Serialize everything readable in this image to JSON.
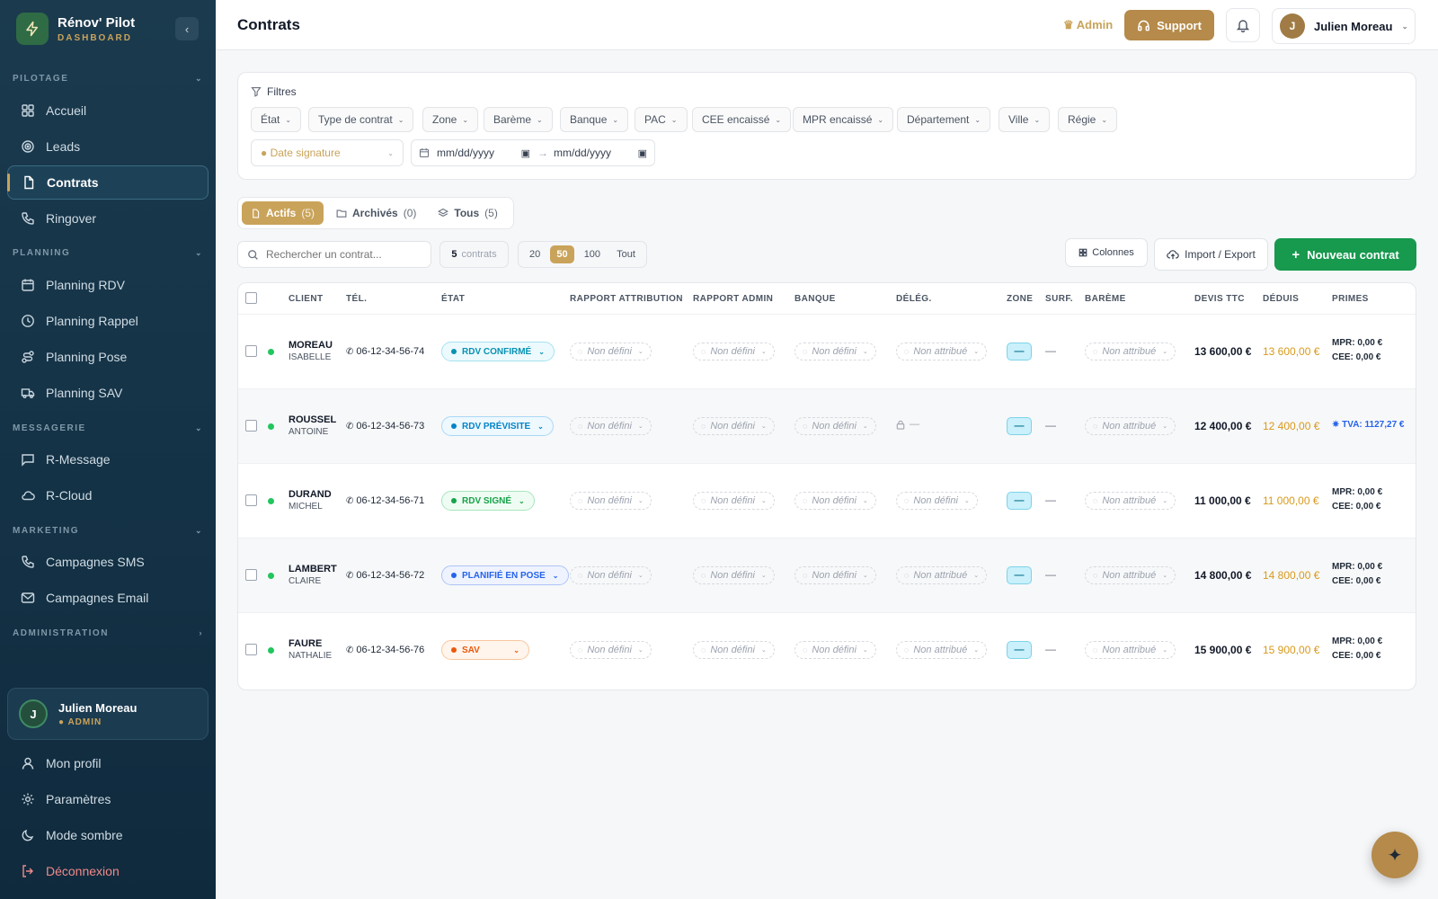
{
  "brand": {
    "name": "Rénov' Pilot",
    "sub": "DASHBOARD"
  },
  "sidebar": {
    "sections": [
      {
        "label": "PILOTAGE"
      },
      {
        "label": "PLANNING"
      },
      {
        "label": "MESSAGERIE"
      },
      {
        "label": "MARKETING"
      },
      {
        "label": "ADMINISTRATION"
      }
    ],
    "items": [
      {
        "label": "Accueil",
        "icon": "grid-icon"
      },
      {
        "label": "Leads",
        "icon": "target-icon"
      },
      {
        "label": "Contrats",
        "icon": "document-icon",
        "active": true
      },
      {
        "label": "Ringover",
        "icon": "phone-icon"
      },
      {
        "label": "Planning RDV",
        "icon": "calendar-icon"
      },
      {
        "label": "Planning Rappel",
        "icon": "clock-icon"
      },
      {
        "label": "Planning Pose",
        "icon": "route-icon"
      },
      {
        "label": "Planning SAV",
        "icon": "truck-icon"
      },
      {
        "label": "R-Message",
        "icon": "message-icon"
      },
      {
        "label": "R-Cloud",
        "icon": "cloud-icon"
      },
      {
        "label": "Campagnes SMS",
        "icon": "phone-icon"
      },
      {
        "label": "Campagnes Email",
        "icon": "mail-icon"
      }
    ],
    "user": {
      "name": "Julien Moreau",
      "initial": "J",
      "role": "ADMIN"
    },
    "bottom": [
      {
        "label": "Mon profil",
        "icon": "user-icon"
      },
      {
        "label": "Paramètres",
        "icon": "gear-icon"
      },
      {
        "label": "Mode sombre",
        "icon": "moon-icon"
      },
      {
        "label": "Déconnexion",
        "icon": "logout-icon"
      }
    ]
  },
  "header": {
    "title": "Contrats",
    "admin_label": "Admin",
    "support_label": "Support",
    "user_name": "Julien Moreau",
    "user_initial": "J"
  },
  "filters": {
    "title": "Filtres",
    "chips": [
      "État",
      "Type de contrat",
      "Zone",
      "Barème",
      "Banque",
      "PAC",
      "CEE encaissé",
      "MPR encaissé",
      "Département",
      "Ville",
      "Régie"
    ],
    "date_field": "Date signature",
    "date_from": "mm/dd/yyyy",
    "date_to": "mm/dd/yyyy",
    "range_sep": "→"
  },
  "tabs": [
    {
      "label": "Actifs",
      "count": "(5)",
      "active": true
    },
    {
      "label": "Archivés",
      "count": "(0)"
    },
    {
      "label": "Tous",
      "count": "(5)"
    }
  ],
  "toolbar": {
    "search_placeholder": "Rechercher un contrat...",
    "count_num": "5",
    "count_label": "contrats",
    "page_sizes": [
      "20",
      "50",
      "100",
      "Tout"
    ],
    "page_size_selected": "50",
    "columns_label": "Colonnes",
    "import_export_label": "Import / Export",
    "new_contract_label": "Nouveau contrat"
  },
  "table": {
    "headers": [
      "CLIENT",
      "TÉL.",
      "ÉTAT",
      "RAPPORT ATTRIBUTION",
      "RAPPORT ADMIN",
      "BANQUE",
      "DÉLÉG.",
      "ZONE",
      "SURF.",
      "BARÈME",
      "DEVIS TTC",
      "DÉDUIS",
      "PRIMES"
    ],
    "rows": [
      {
        "last": "MOREAU",
        "first": "ISABELLE",
        "tel": "06-12-34-56-74",
        "status": "RDV CONFIRMÉ",
        "status_color": "#0891b2",
        "status_bg": "#ecfafe",
        "rapport_attr": "Non défini",
        "rapport_admin": "Non défini",
        "banque": "Non défini",
        "deleg": "Non attribué",
        "zone": "—",
        "surf": "—",
        "bareme": "Non attribué",
        "devis": "13 600,00 €",
        "deduis": "13 600,00 €",
        "mpr": "MPR: 0,00 €",
        "cee": "CEE: 0,00 €"
      },
      {
        "last": "ROUSSEL",
        "first": "ANTOINE",
        "tel": "06-12-34-56-73",
        "status": "RDV PRÉVISITE",
        "status_color": "#0284c7",
        "status_bg": "#eef8ff",
        "rapport_attr": "Non défini",
        "rapport_admin": "Non défini",
        "banque": "Non défini",
        "deleg": "—",
        "deleg_locked": true,
        "zone": "—",
        "surf": "—",
        "bareme": "Non attribué",
        "devis": "12 400,00 €",
        "deduis": "12 400,00 €",
        "tva": "TVA: 1127,27 €"
      },
      {
        "last": "DURAND",
        "first": "MICHEL",
        "tel": "06-12-34-56-71",
        "status": "RDV SIGNÉ",
        "status_color": "#16a34a",
        "status_bg": "#effcf3",
        "rapport_attr": "Non défini",
        "rapport_admin": "Non défini",
        "banque": "Non défini",
        "deleg": "Non défini",
        "zone": "—",
        "surf": "—",
        "bareme": "Non attribué",
        "devis": "11 000,00 €",
        "deduis": "11 000,00 €",
        "mpr": "MPR: 0,00 €",
        "cee": "CEE: 0,00 €"
      },
      {
        "last": "LAMBERT",
        "first": "CLAIRE",
        "tel": "06-12-34-56-72",
        "status": "PLANIFIÉ EN POSE",
        "status_color": "#2563eb",
        "status_bg": "#eef3ff",
        "rapport_attr": "Non défini",
        "rapport_admin": "Non défini",
        "banque": "Non défini",
        "deleg": "Non attribué",
        "zone": "—",
        "surf": "—",
        "bareme": "Non attribué",
        "devis": "14 800,00 €",
        "deduis": "14 800,00 €",
        "mpr": "MPR: 0,00 €",
        "cee": "CEE: 0,00 €"
      },
      {
        "last": "FAURE",
        "first": "NATHALIE",
        "tel": "06-12-34-56-76",
        "status": "SAV",
        "status_color": "#ea580c",
        "status_bg": "#fff5ec",
        "rapport_attr": "Non défini",
        "rapport_admin": "Non défini",
        "banque": "Non défini",
        "deleg": "Non attribué",
        "zone": "—",
        "surf": "—",
        "bareme": "Non attribué",
        "devis": "15 900,00 €",
        "deduis": "15 900,00 €",
        "mpr": "MPR: 0,00 €",
        "cee": "CEE: 0,00 €"
      }
    ]
  },
  "fab_icon": "sparkle-icon"
}
